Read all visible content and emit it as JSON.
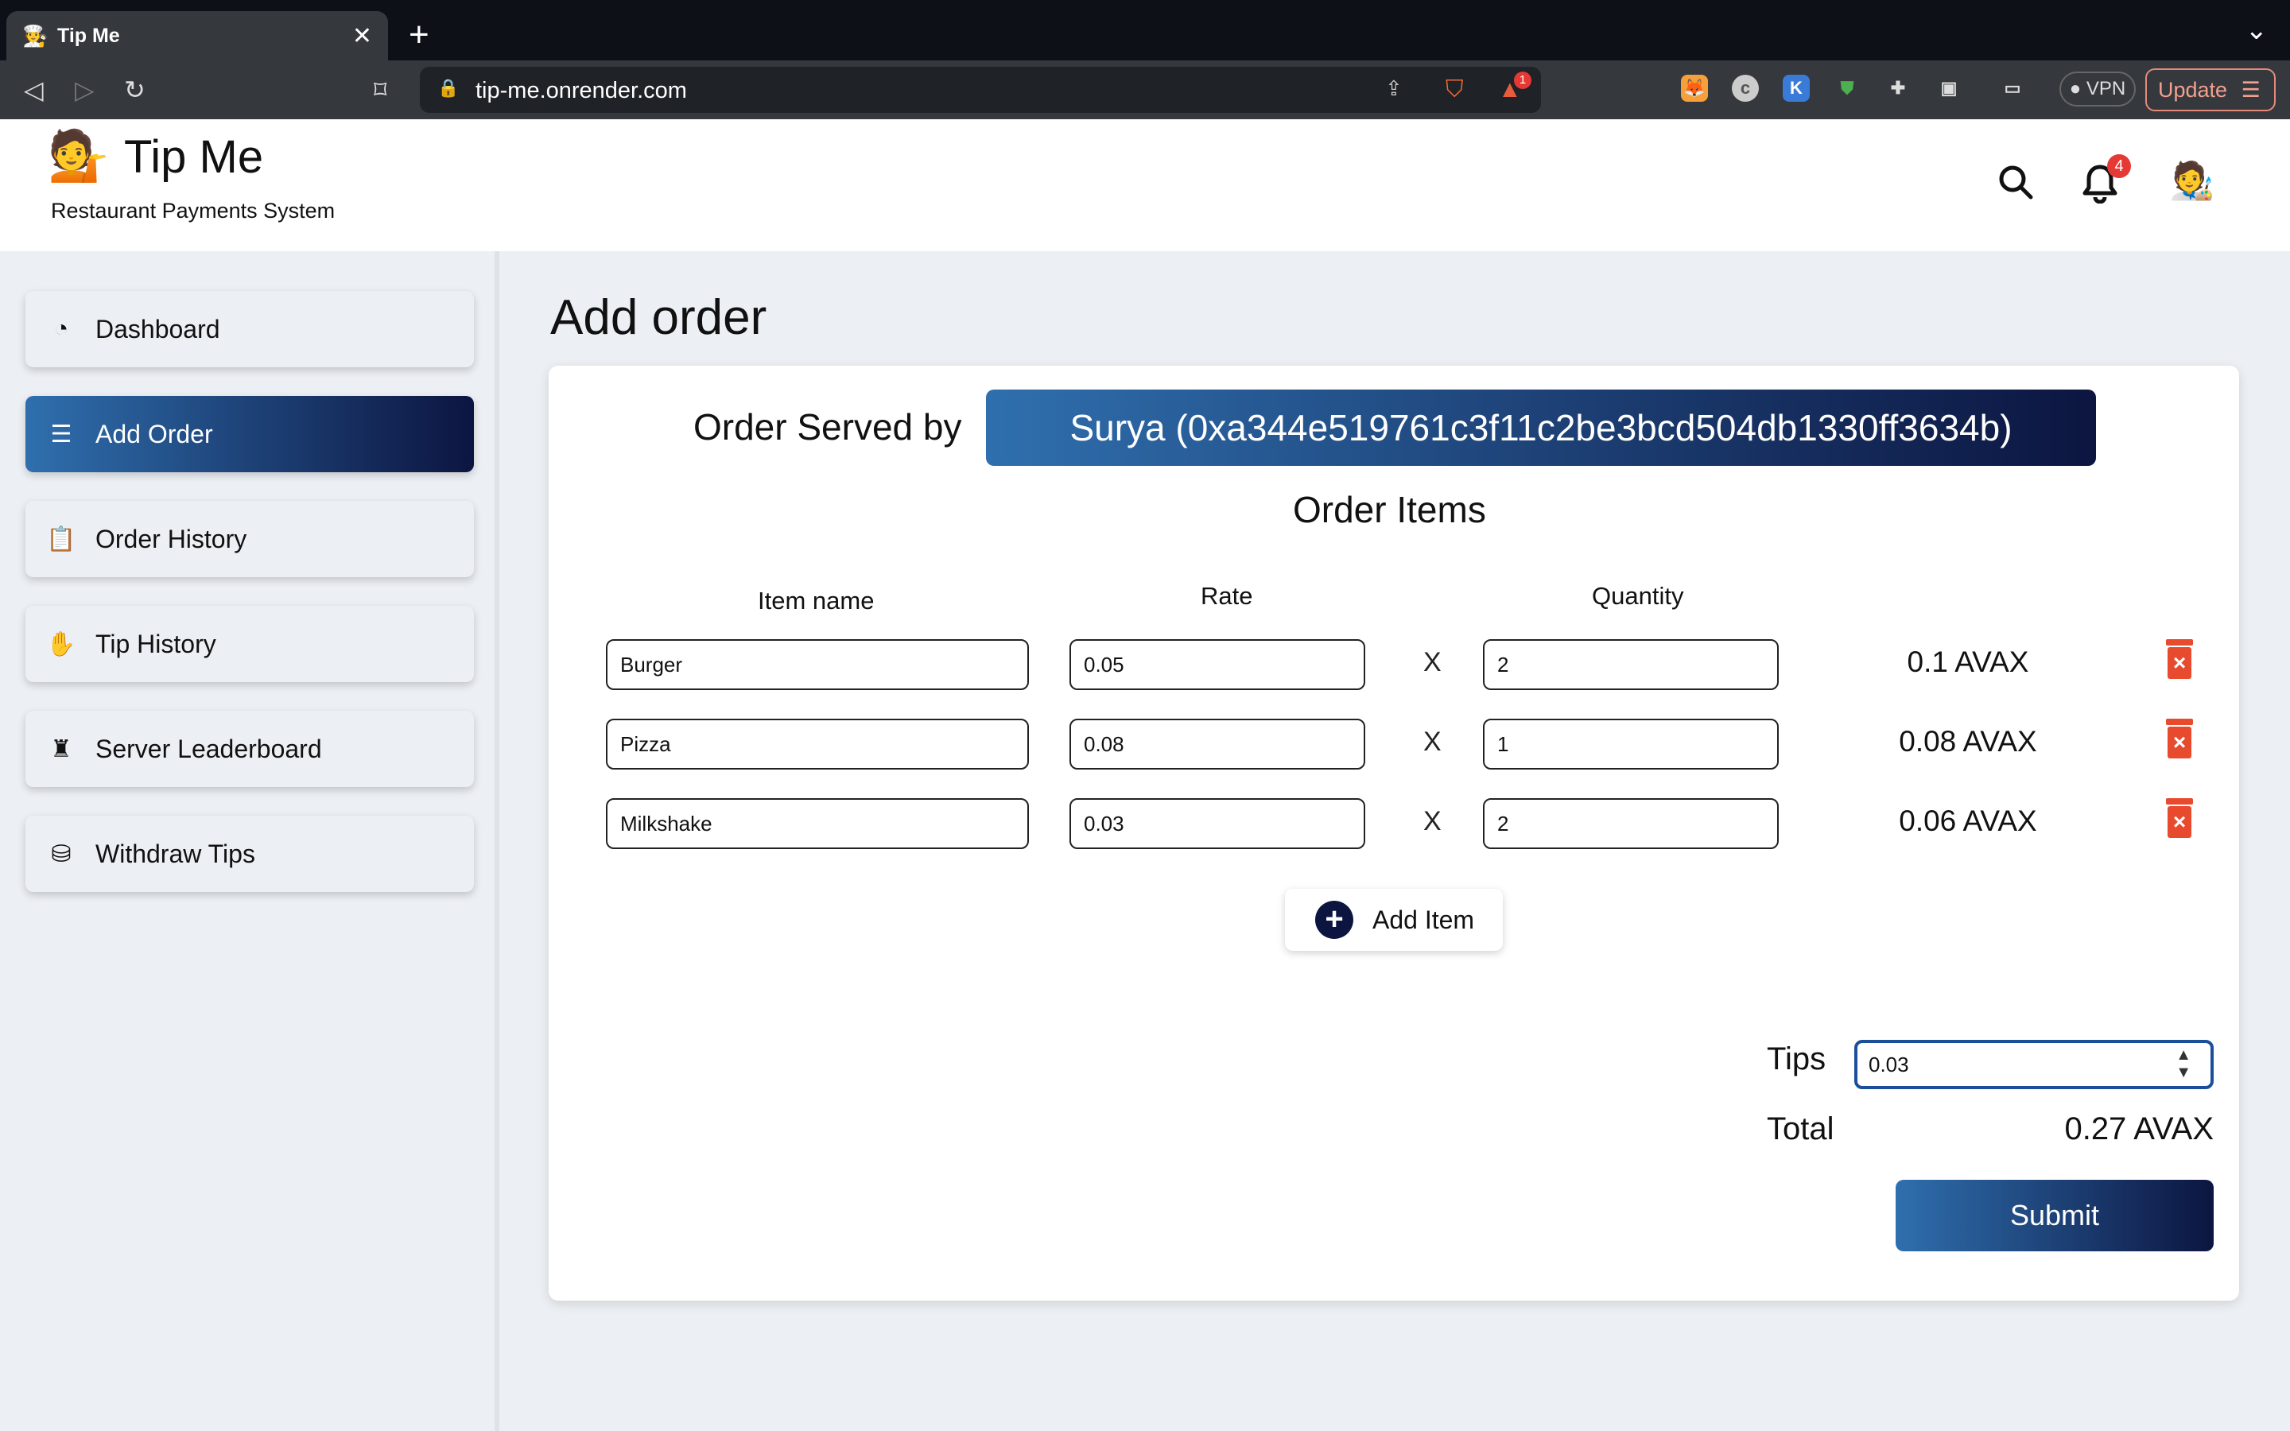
{
  "browser": {
    "tab_title": "Tip Me",
    "url": "tip-me.onrender.com",
    "vpn_label": "VPN",
    "update_label": "Update",
    "brave_badge": "1"
  },
  "header": {
    "brand": "Tip Me",
    "tagline": "Restaurant Payments System",
    "notification_count": "4"
  },
  "sidebar": {
    "items": [
      {
        "label": "Dashboard",
        "icon": "gauge-icon"
      },
      {
        "label": "Add Order",
        "icon": "burger-icon",
        "active": true
      },
      {
        "label": "Order History",
        "icon": "clipboard-icon"
      },
      {
        "label": "Tip History",
        "icon": "hand-coin-icon"
      },
      {
        "label": "Server Leaderboard",
        "icon": "waiter-icon"
      },
      {
        "label": "Withdraw Tips",
        "icon": "withdraw-icon"
      }
    ]
  },
  "main": {
    "title": "Add order",
    "served_by_label": "Order Served by",
    "waiter": "Surya (0xa344e519761c3f11c2be3bcd504db1330ff3634b)",
    "order_items_title": "Order Items",
    "columns": {
      "item": "Item name",
      "rate": "Rate",
      "quantity": "Quantity"
    },
    "times_symbol": "X",
    "rows": [
      {
        "item": "Burger",
        "rate": "0.05",
        "qty": "2",
        "amount": "0.1 AVAX"
      },
      {
        "item": "Pizza",
        "rate": "0.08",
        "qty": "1",
        "amount": "0.08 AVAX"
      },
      {
        "item": "Milkshake",
        "rate": "0.03",
        "qty": "2",
        "amount": "0.06 AVAX"
      }
    ],
    "add_item_label": "Add Item",
    "tips_label": "Tips",
    "tips_value": "0.03",
    "total_label": "Total",
    "total_value": "0.27 AVAX",
    "submit_label": "Submit"
  },
  "colors": {
    "accent_start": "#2f6fae",
    "accent_end": "#0c1540",
    "delete": "#e84a2e",
    "badge": "#e53935"
  }
}
